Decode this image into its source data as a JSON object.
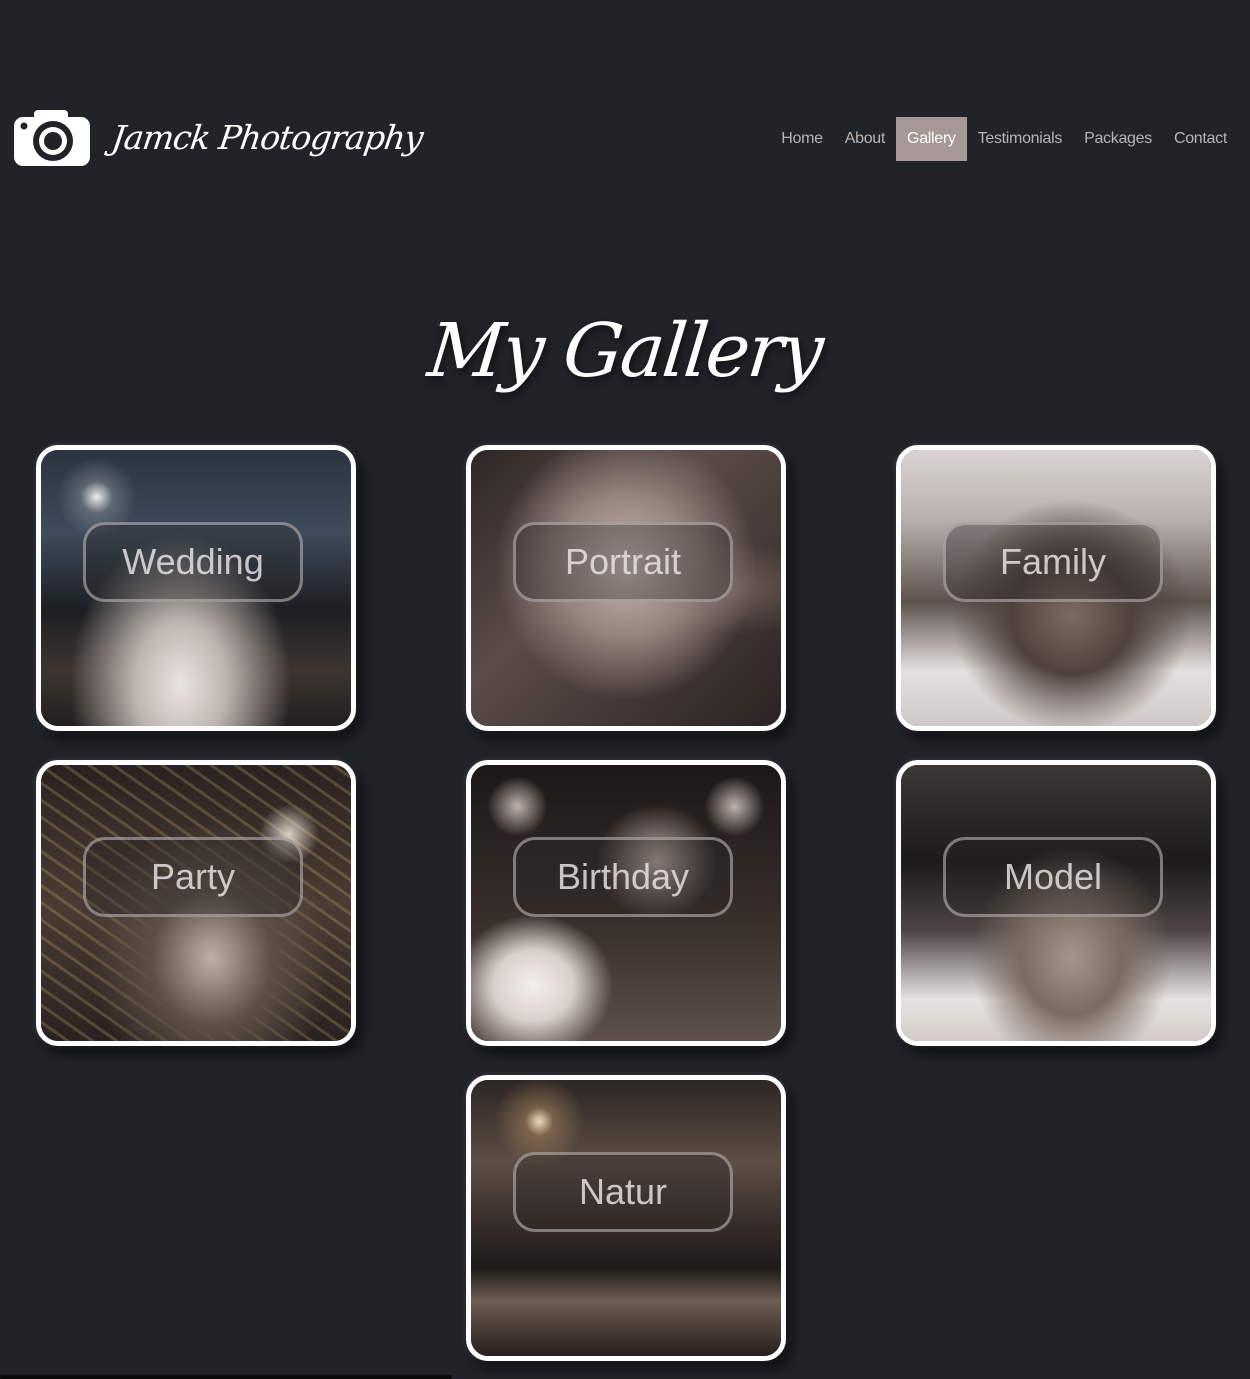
{
  "brand": {
    "name": "Jamck Photography",
    "logo_icon": "camera-icon"
  },
  "nav": {
    "items": [
      {
        "label": "Home"
      },
      {
        "label": "About"
      },
      {
        "label": "Gallery",
        "active": true
      },
      {
        "label": "Testimonials"
      },
      {
        "label": "Packages"
      },
      {
        "label": "Contact"
      }
    ]
  },
  "page": {
    "title": "My Gallery"
  },
  "gallery": {
    "cards": [
      {
        "label": "Wedding"
      },
      {
        "label": "Portrait"
      },
      {
        "label": "Family"
      },
      {
        "label": "Party"
      },
      {
        "label": "Birthday"
      },
      {
        "label": "Model"
      },
      {
        "label": "Natur"
      }
    ]
  },
  "colors": {
    "background": "#202328",
    "nav_active": "#a59896",
    "nav_text": "#b9b3b2"
  }
}
